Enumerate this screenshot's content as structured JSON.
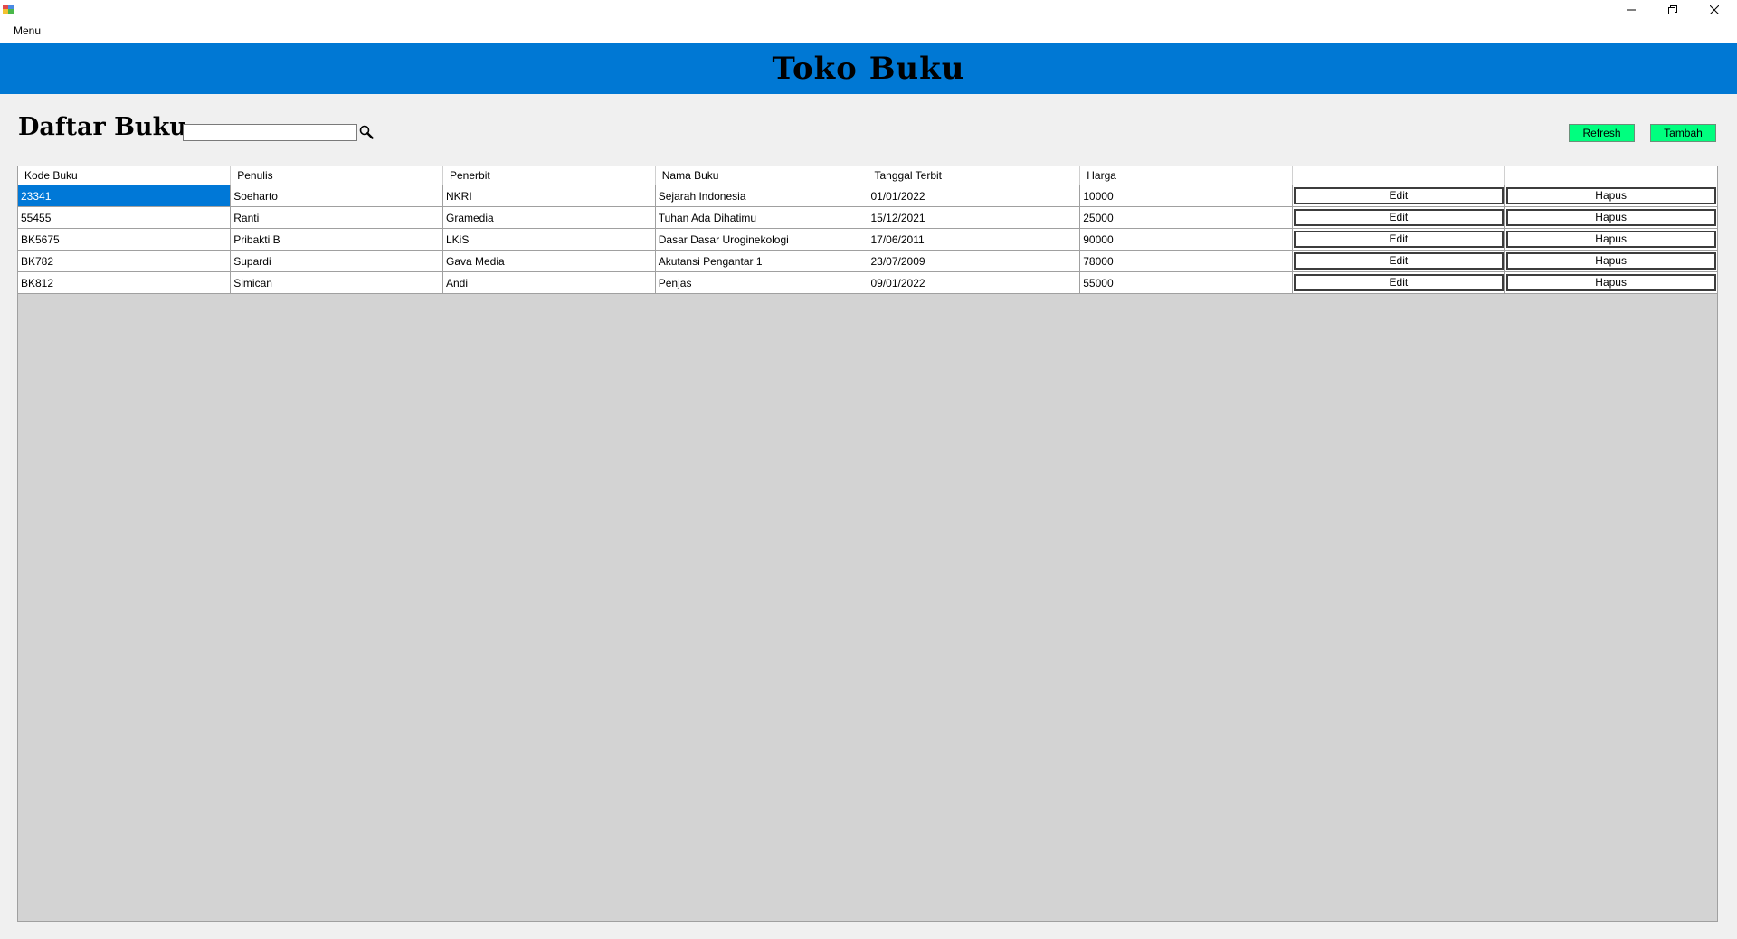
{
  "window": {
    "title": "",
    "controls": {
      "minimize_icon": "minimize-icon",
      "restore_icon": "restore-icon",
      "close_icon": "close-icon"
    }
  },
  "menu": {
    "items": [
      {
        "label": "Menu"
      }
    ]
  },
  "header": {
    "title": "Toko Buku",
    "background": "#0078d4"
  },
  "toolbar": {
    "page_title": "Daftar Buku",
    "search": {
      "value": "",
      "placeholder": "",
      "icon": "search-icon"
    },
    "refresh_label": "Refresh",
    "tambah_label": "Tambah",
    "button_color": "#00ff7f"
  },
  "grid": {
    "columns": [
      "Kode Buku",
      "Penulis",
      "Penerbit",
      "Nama Buku",
      "Tanggal Terbit",
      "Harga",
      "",
      ""
    ],
    "edit_label": "Edit",
    "hapus_label": "Hapus",
    "selected_cell": {
      "row": 0,
      "column": "Kode Buku",
      "color": "#0078d7"
    },
    "rows": [
      {
        "kode": "23341",
        "penulis": "Soeharto",
        "penerbit": "NKRI",
        "nama": "Sejarah Indonesia",
        "tanggal": "01/01/2022",
        "harga": "10000"
      },
      {
        "kode": "55455",
        "penulis": "Ranti",
        "penerbit": "Gramedia",
        "nama": "Tuhan Ada Dihatimu",
        "tanggal": "15/12/2021",
        "harga": "25000"
      },
      {
        "kode": "BK5675",
        "penulis": "Pribakti B",
        "penerbit": "LKiS",
        "nama": "Dasar Dasar Uroginekologi",
        "tanggal": "17/06/2011",
        "harga": "90000"
      },
      {
        "kode": "BK782",
        "penulis": "Supardi",
        "penerbit": "Gava Media",
        "nama": "Akutansi Pengantar 1",
        "tanggal": "23/07/2009",
        "harga": "78000"
      },
      {
        "kode": "BK812",
        "penulis": "Simican",
        "penerbit": "Andi",
        "nama": "Penjas",
        "tanggal": "09/01/2022",
        "harga": "55000"
      }
    ]
  }
}
